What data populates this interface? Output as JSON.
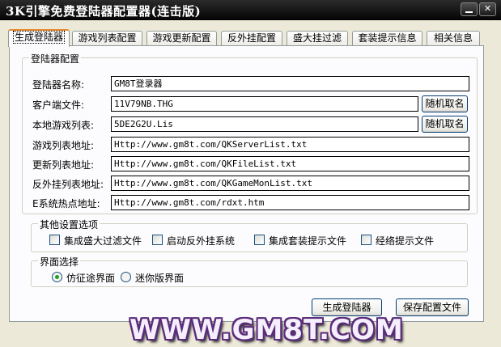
{
  "window": {
    "title": "3K引擎免费登陆器配置器(连击版)"
  },
  "tabs": [
    {
      "label": "生成登陆器",
      "active": true
    },
    {
      "label": "游戏列表配置",
      "active": false
    },
    {
      "label": "游戏更新配置",
      "active": false
    },
    {
      "label": "反外挂配置",
      "active": false
    },
    {
      "label": "盛大挂过滤",
      "active": false
    },
    {
      "label": "套装提示信息",
      "active": false
    },
    {
      "label": "相关信息",
      "active": false
    }
  ],
  "config_group": {
    "title": "登陆器配置",
    "fields": [
      {
        "label": "登陆器名称:",
        "value": "GM8T登录器"
      },
      {
        "label": "客户端文件:",
        "value": "11V79NB.THG"
      },
      {
        "label": "本地游戏列表:",
        "value": "5DE2G2U.Lis"
      },
      {
        "label": "游戏列表地址:",
        "value": "Http://www.gm8t.com/QKServerList.txt"
      },
      {
        "label": "更新列表地址:",
        "value": "Http://www.gm8t.com/QKFileList.txt"
      },
      {
        "label": "反外挂列表地址:",
        "value": "Http://www.gm8t.com/QKGameMonList.txt"
      },
      {
        "label": "E系统热点地址:",
        "value": "Http://www.gm8t.com/rdxt.htm"
      }
    ],
    "random_name_label": "随机取名"
  },
  "other_group": {
    "title": "其他设置选项",
    "options": [
      {
        "label": "集成盛大过滤文件",
        "checked": false
      },
      {
        "label": "启动反外挂系统",
        "checked": false
      },
      {
        "label": "集成套装提示文件",
        "checked": false
      },
      {
        "label": "经络提示文件",
        "checked": false
      }
    ]
  },
  "ui_group": {
    "title": "界面选择",
    "options": [
      {
        "label": "仿征途界面",
        "selected": true
      },
      {
        "label": "迷你版界面",
        "selected": false
      }
    ]
  },
  "buttons": {
    "generate": "生成登陆器",
    "save": "保存配置文件"
  },
  "watermark": "WWW.GM8T.COM",
  "colors": {
    "titlebar": "#0a0a0a",
    "active_tab_accent": "#e68b2c",
    "radio_dot": "#21a121",
    "watermark_outline": "#5a2c7a"
  }
}
